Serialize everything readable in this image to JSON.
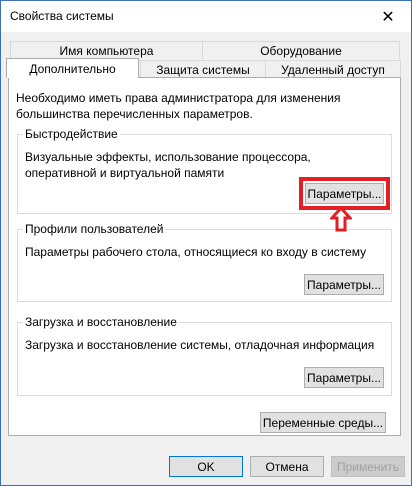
{
  "window": {
    "title": "Свойства системы",
    "close_symbol": "✕"
  },
  "tabs": {
    "row1": [
      {
        "label": "Имя компьютера"
      },
      {
        "label": "Оборудование"
      }
    ],
    "row2": [
      {
        "label": "Дополнительно",
        "selected": true
      },
      {
        "label": "Защита системы"
      },
      {
        "label": "Удаленный доступ"
      }
    ]
  },
  "panel": {
    "intro_text": "Необходимо иметь права администратора для изменения большинства перечисленных параметров.",
    "performance": {
      "legend": "Быстродействие",
      "description": "Визуальные эффекты, использование процессора, оперативной и виртуальной памяти",
      "button_label": "Параметры..."
    },
    "user_profiles": {
      "legend": "Профили пользователей",
      "description": "Параметры рабочего стола, относящиеся ко входу в систему",
      "button_label": "Параметры..."
    },
    "startup_recovery": {
      "legend": "Загрузка и восстановление",
      "description": "Загрузка и восстановление системы, отладочная информация",
      "button_label": "Параметры..."
    },
    "env_vars_button_label": "Переменные среды..."
  },
  "footer": {
    "ok_label": "OK",
    "cancel_label": "Отмена",
    "apply_label": "Применить"
  },
  "annotation": {
    "highlight_color": "#e31e24",
    "arrow_icon": "arrow-up-icon"
  },
  "colors": {
    "accent_border": "#0078d7",
    "window_border": "#3c6fb4"
  }
}
